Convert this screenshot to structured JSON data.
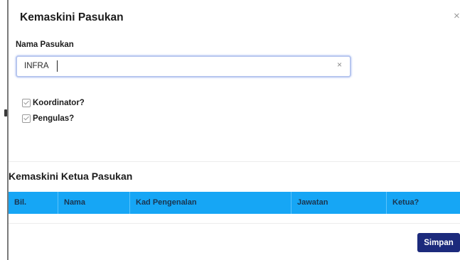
{
  "modal": {
    "title": "Kemaskini Pasukan",
    "close_label": "×"
  },
  "form": {
    "name_label": "Nama Pasukan",
    "name_value": "INFRA",
    "clear_label": "×",
    "checkboxes": [
      {
        "label": "Koordinator?",
        "checked": true
      },
      {
        "label": "Pengulas?",
        "checked": true
      }
    ]
  },
  "leaders": {
    "title": "Kemaskini Ketua Pasukan",
    "columns": [
      "Bil.",
      "Nama",
      "Kad Pengenalan",
      "Jawatan",
      "Ketua?"
    ],
    "rows": []
  },
  "actions": {
    "save_label": "Simpan"
  },
  "colors": {
    "table_header": "#16a6f5",
    "save_button": "#1c2a7c",
    "input_focus_border": "#b7c6ef"
  }
}
